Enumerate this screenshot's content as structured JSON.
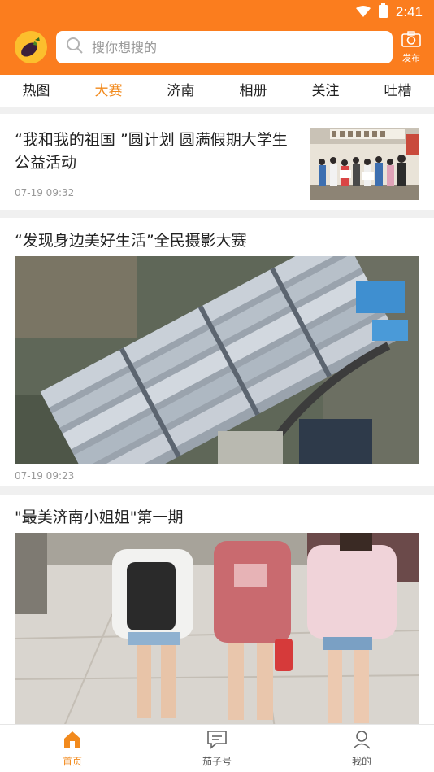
{
  "status_bar": {
    "time": "2:41"
  },
  "header": {
    "search_placeholder": "搜你想搜的",
    "publish_label": "发布"
  },
  "tabs": [
    {
      "label": "热图",
      "active": false
    },
    {
      "label": "大赛",
      "active": true
    },
    {
      "label": "济南",
      "active": false
    },
    {
      "label": "相册",
      "active": false
    },
    {
      "label": "关注",
      "active": false
    },
    {
      "label": "吐槽",
      "active": false
    }
  ],
  "feed": [
    {
      "title": "“我和我的祖国 ”圆计划 圆满假期大学生公益活动",
      "time": "07-19 09:32"
    },
    {
      "title": "“发现身边美好生活”全民摄影大赛",
      "time": "07-19 09:23"
    },
    {
      "title": "\"最美济南小姐姐\"第一期"
    }
  ],
  "bottom_nav": [
    {
      "label": "首页",
      "icon": "home-icon",
      "active": true
    },
    {
      "label": "茄子号",
      "icon": "message-icon",
      "active": false
    },
    {
      "label": "我的",
      "icon": "user-icon",
      "active": false
    }
  ],
  "colors": {
    "accent": "#fb7d1e",
    "active_tab": "#f28a1d"
  }
}
